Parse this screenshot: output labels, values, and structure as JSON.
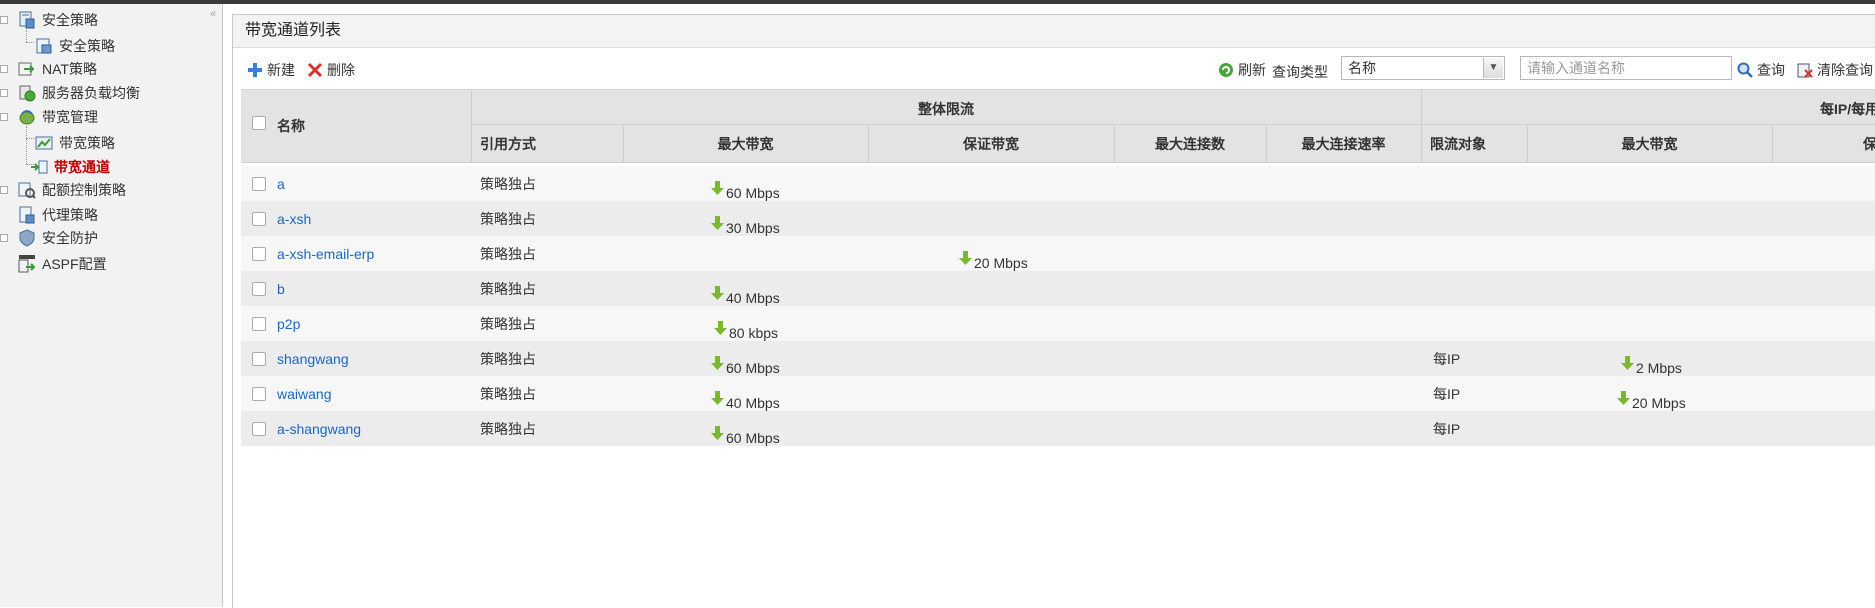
{
  "sidebar": {
    "items": [
      {
        "label": "安全策略",
        "icon": "security-policy-icon"
      },
      {
        "label": "安全策略",
        "icon": "policy-document-icon"
      },
      {
        "label": "NAT策略",
        "icon": "nat-icon"
      },
      {
        "label": "服务器负载均衡",
        "icon": "load-balance-icon"
      },
      {
        "label": "带宽管理",
        "icon": "bandwidth-management-icon"
      },
      {
        "label": "带宽策略",
        "icon": "bandwidth-policy-icon"
      },
      {
        "label": "带宽通道",
        "icon": "bandwidth-channel-icon"
      },
      {
        "label": "配额控制策略",
        "icon": "quota-control-icon"
      },
      {
        "label": "代理策略",
        "icon": "proxy-policy-icon"
      },
      {
        "label": "安全防护",
        "icon": "shield-icon"
      },
      {
        "label": "ASPF配置",
        "icon": "aspf-icon"
      }
    ],
    "collapse_label": "«"
  },
  "panel": {
    "title": "带宽通道列表"
  },
  "toolbar": {
    "new_label": "新建",
    "delete_label": "删除",
    "refresh_label": "刷新",
    "query_type_label": "查询类型",
    "query_type_value": "名称",
    "search_placeholder": "请输入通道名称",
    "query_label": "查询",
    "clear_label": "清除查询"
  },
  "table": {
    "headers": {
      "name": "名称",
      "overall_group": "整体限流",
      "per_ip_group": "每IP/每用",
      "reference_mode": "引用方式",
      "max_bandwidth": "最大带宽",
      "guaranteed_bandwidth": "保证带宽",
      "max_connections": "最大连接数",
      "max_connection_rate": "最大连接速率",
      "limit_target": "限流对象",
      "per_max_bandwidth": "最大带宽",
      "per_guaranteed_truncated": "保"
    },
    "rows": [
      {
        "name": "a",
        "ref": "策略独占",
        "max_bw": "60 Mbps",
        "guar_bw": "",
        "target": "",
        "per_max_bw": ""
      },
      {
        "name": "a-xsh",
        "ref": "策略独占",
        "max_bw": "30 Mbps",
        "guar_bw": "",
        "target": "",
        "per_max_bw": ""
      },
      {
        "name": "a-xsh-email-erp",
        "ref": "策略独占",
        "max_bw": "",
        "guar_bw": "20 Mbps",
        "target": "",
        "per_max_bw": ""
      },
      {
        "name": "b",
        "ref": "策略独占",
        "max_bw": "40 Mbps",
        "guar_bw": "",
        "target": "",
        "per_max_bw": ""
      },
      {
        "name": "p2p",
        "ref": "策略独占",
        "max_bw": "80 kbps",
        "guar_bw": "",
        "target": "",
        "per_max_bw": ""
      },
      {
        "name": "shangwang",
        "ref": "策略独占",
        "max_bw": "60 Mbps",
        "guar_bw": "",
        "target": "每IP",
        "per_max_bw": "2 Mbps"
      },
      {
        "name": "waiwang",
        "ref": "策略独占",
        "max_bw": "40 Mbps",
        "guar_bw": "",
        "target": "每IP",
        "per_max_bw": "20 Mbps"
      },
      {
        "name": "a-shangwang",
        "ref": "策略独占",
        "max_bw": "60 Mbps",
        "guar_bw": "",
        "target": "每IP",
        "per_max_bw": ""
      }
    ]
  },
  "colors": {
    "link": "#1a66c2",
    "active_nav": "#c00000",
    "arrow_green": "#7cb82f"
  }
}
